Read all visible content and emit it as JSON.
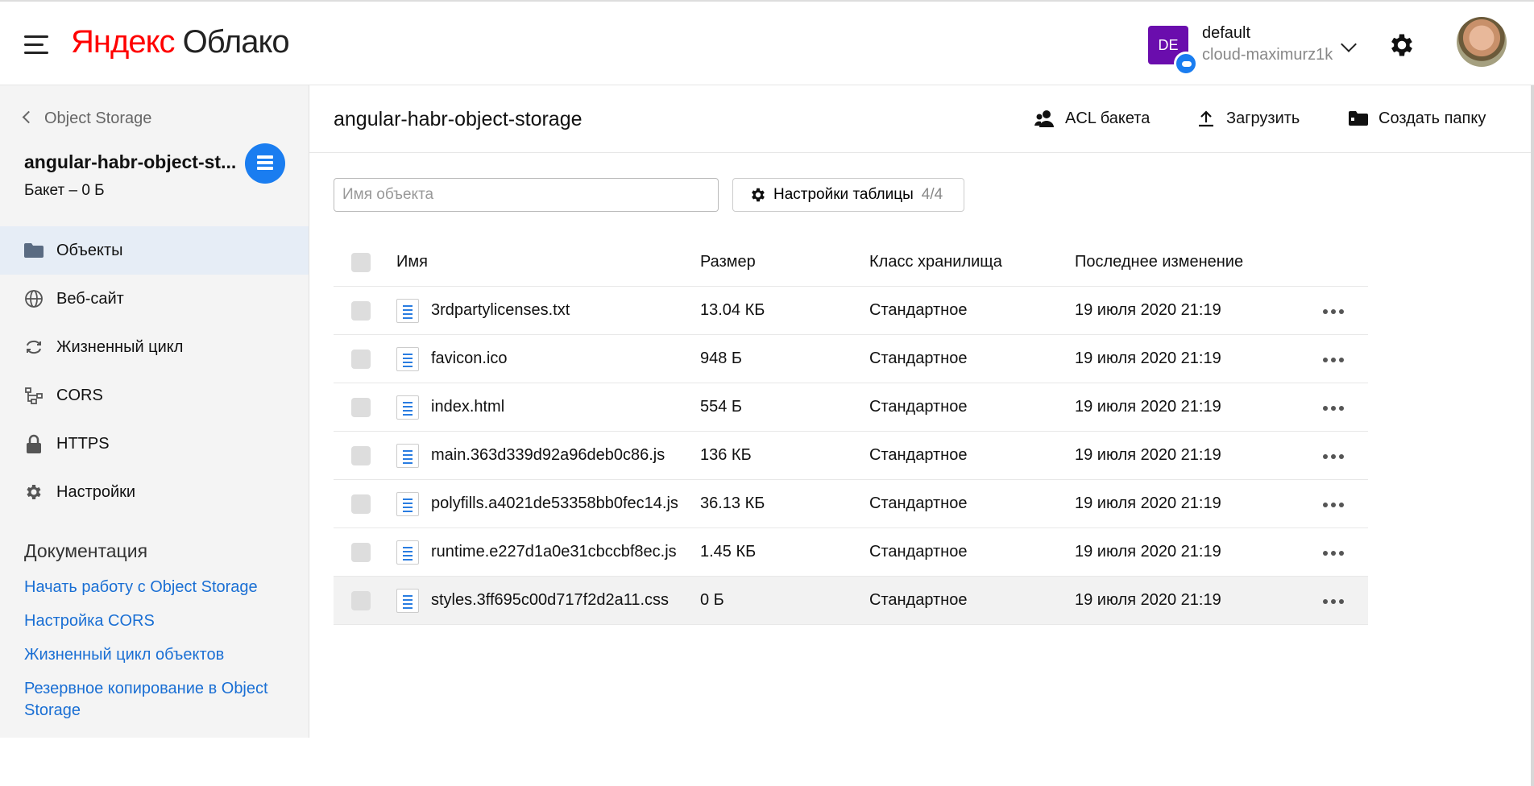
{
  "header": {
    "logo_ya": "Яндекс",
    "logo_cloud": "Облако",
    "account": {
      "badge": "DE",
      "name": "default",
      "cloud_id": "cloud-maximurz1k"
    }
  },
  "sidebar": {
    "back_label": "Object Storage",
    "bucket_title": "angular-habr-object-st...",
    "bucket_subtitle": "Бакет – 0 Б",
    "items": [
      {
        "label": "Объекты",
        "icon": "folder-icon",
        "active": true
      },
      {
        "label": "Веб-сайт",
        "icon": "globe-icon"
      },
      {
        "label": "Жизненный цикл",
        "icon": "cycle-icon"
      },
      {
        "label": "CORS",
        "icon": "cors-icon"
      },
      {
        "label": "HTTPS",
        "icon": "lock-icon"
      },
      {
        "label": "Настройки",
        "icon": "gear-icon"
      }
    ],
    "docs_title": "Документация",
    "docs": [
      "Начать работу с Object Storage",
      "Настройка CORS",
      "Жизненный цикл объектов",
      "Резервное копирование в Object Storage"
    ]
  },
  "main": {
    "title": "angular-habr-object-storage",
    "actions": {
      "acl": "ACL бакета",
      "upload": "Загрузить",
      "new_folder": "Создать папку"
    },
    "search_placeholder": "Имя объекта",
    "table_settings": {
      "label": "Настройки таблицы",
      "count": "4/4"
    },
    "columns": {
      "name": "Имя",
      "size": "Размер",
      "class": "Класс хранилища",
      "modified": "Последнее изменение"
    },
    "rows": [
      {
        "name": "3rdpartylicenses.txt",
        "size": "13.04 КБ",
        "class": "Стандартное",
        "modified": "19 июля 2020 21:19"
      },
      {
        "name": "favicon.ico",
        "size": "948 Б",
        "class": "Стандартное",
        "modified": "19 июля 2020 21:19"
      },
      {
        "name": "index.html",
        "size": "554 Б",
        "class": "Стандартное",
        "modified": "19 июля 2020 21:19"
      },
      {
        "name": "main.363d339d92a96deb0c86.js",
        "size": "136 КБ",
        "class": "Стандартное",
        "modified": "19 июля 2020 21:19"
      },
      {
        "name": "polyfills.a4021de53358bb0fec14.js",
        "size": "36.13 КБ",
        "class": "Стандартное",
        "modified": "19 июля 2020 21:19"
      },
      {
        "name": "runtime.e227d1a0e31cbccbf8ec.js",
        "size": "1.45 КБ",
        "class": "Стандартное",
        "modified": "19 июля 2020 21:19"
      },
      {
        "name": "styles.3ff695c00d717f2d2a11.css",
        "size": "0 Б",
        "class": "Стандартное",
        "modified": "19 июля 2020 21:19"
      }
    ]
  }
}
